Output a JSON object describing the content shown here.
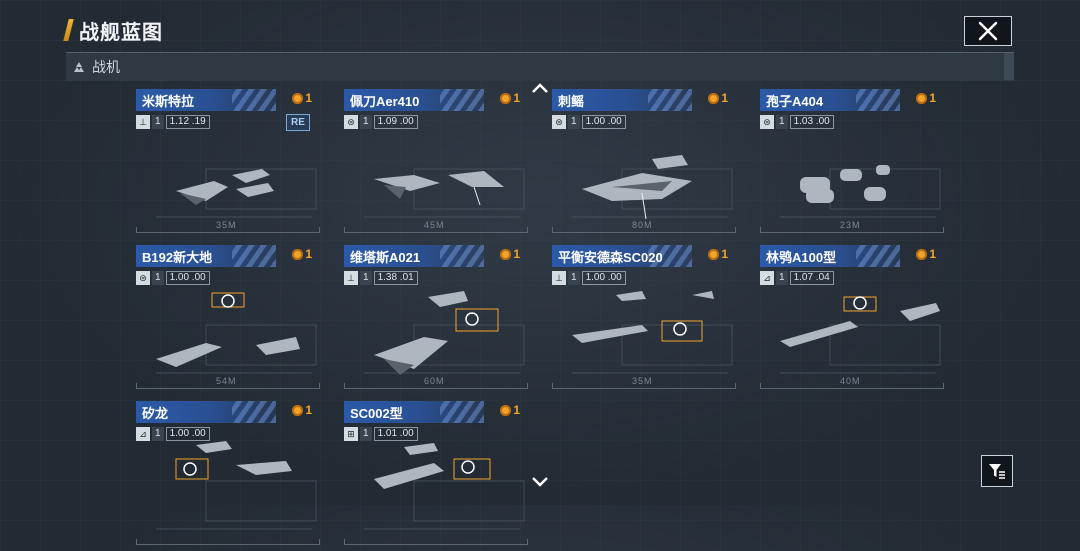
{
  "header": {
    "title": "战舰蓝图"
  },
  "category": {
    "label": "战机"
  },
  "cards": [
    {
      "name": "米斯特拉",
      "cost": "1",
      "count": "1",
      "ratio": "1.12 .19",
      "type_icon": "⊥",
      "tag": "RE",
      "length": "35M"
    },
    {
      "name": "佩刀Aer410",
      "cost": "1",
      "count": "1",
      "ratio": "1.09 .00",
      "type_icon": "⊜",
      "tag": "",
      "length": "45M"
    },
    {
      "name": "刺鳐",
      "cost": "1",
      "count": "1",
      "ratio": "1.00 .00",
      "type_icon": "⊜",
      "tag": "",
      "length": "80M"
    },
    {
      "name": "孢子A404",
      "cost": "1",
      "count": "1",
      "ratio": "1.03 .00",
      "type_icon": "⊜",
      "tag": "",
      "length": "23M"
    },
    {
      "name": "B192新大地",
      "cost": "1",
      "count": "1",
      "ratio": "1.00 .00",
      "type_icon": "⊜",
      "tag": "",
      "length": "54M"
    },
    {
      "name": "维塔斯A021",
      "cost": "1",
      "count": "1",
      "ratio": "1.38 .01",
      "type_icon": "⊥",
      "tag": "",
      "length": "60M"
    },
    {
      "name": "平衡安德森SC020",
      "cost": "1",
      "count": "1",
      "ratio": "1.00 .00",
      "type_icon": "⊥",
      "tag": "",
      "length": "35M"
    },
    {
      "name": "林鸮A100型",
      "cost": "1",
      "count": "1",
      "ratio": "1.07 .04",
      "type_icon": "⊿",
      "tag": "",
      "length": "40M"
    },
    {
      "name": "矽龙",
      "cost": "1",
      "count": "1",
      "ratio": "1.00 .00",
      "type_icon": "⊿",
      "tag": "",
      "length": ""
    },
    {
      "name": "SC002型",
      "cost": "1",
      "count": "1",
      "ratio": "1.01 .00",
      "type_icon": "⊞",
      "tag": "",
      "length": ""
    }
  ],
  "icons": {
    "close": "close-icon",
    "filter": "filter-icon",
    "scroll_up": "chevron-up-icon",
    "scroll_down": "chevron-down-icon",
    "category": "fighter-icon"
  },
  "colors": {
    "accent": "#f2b233",
    "name_bar": "#2b5aa8",
    "cost": "#f2a42b",
    "tag": "#7aa9d8"
  }
}
